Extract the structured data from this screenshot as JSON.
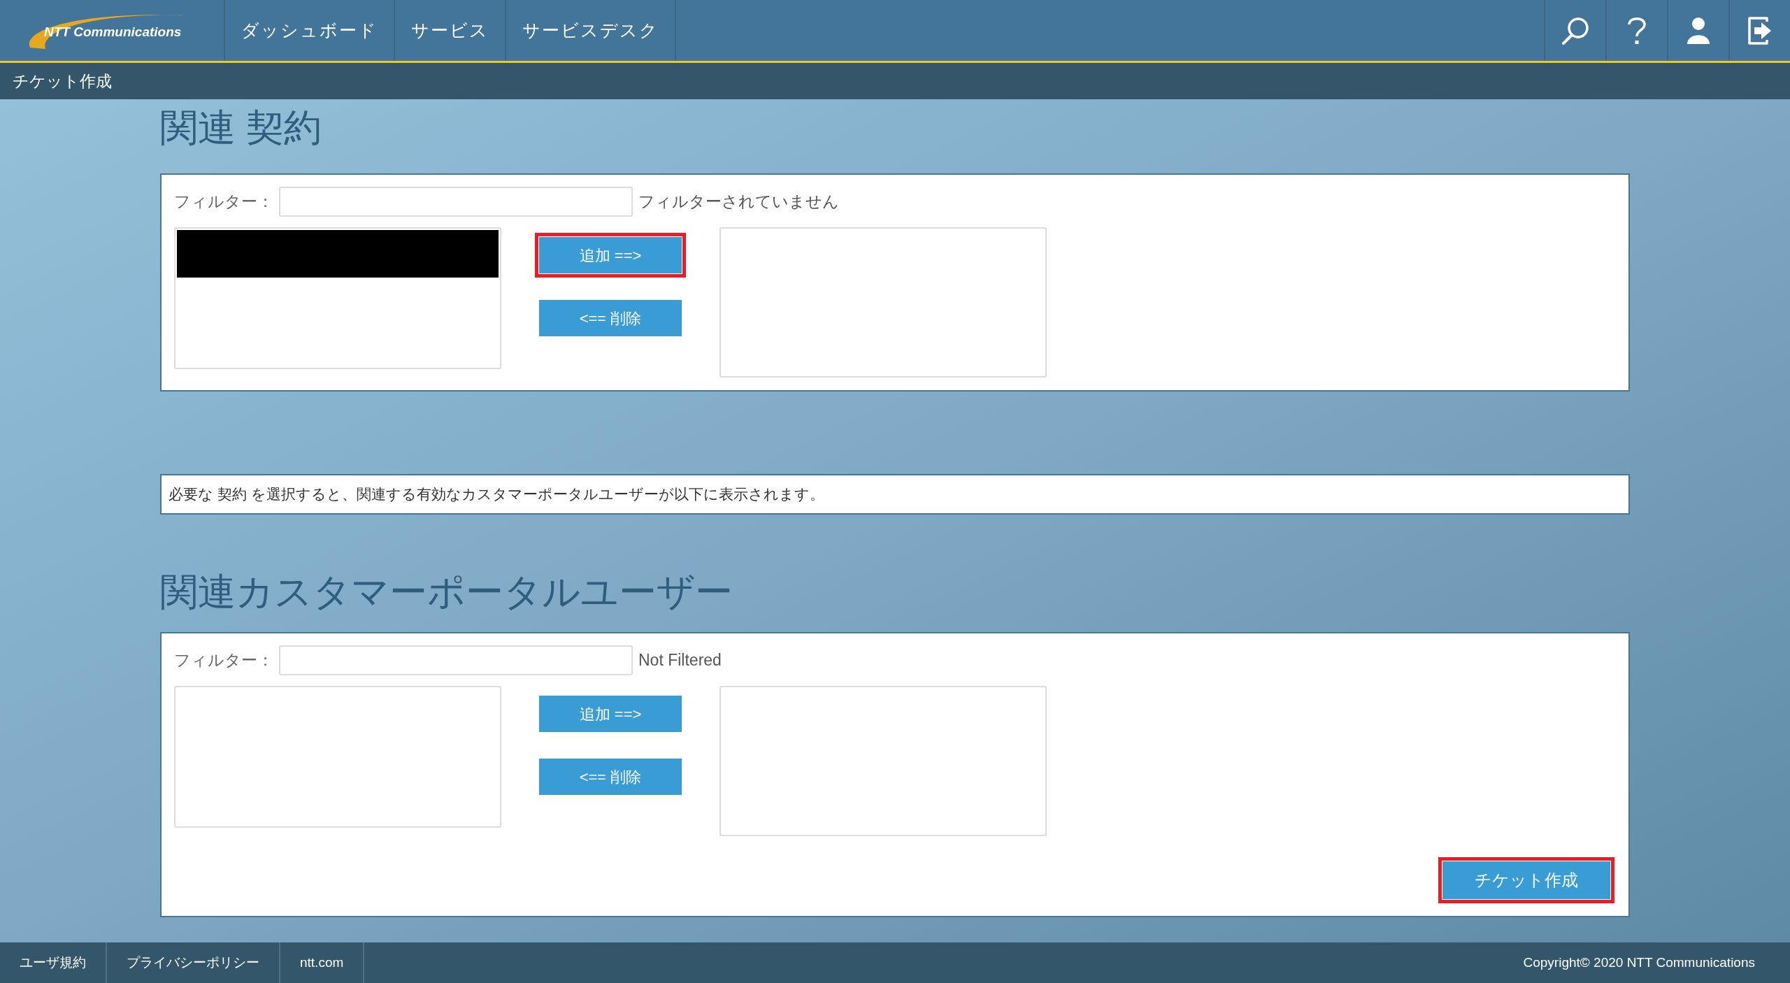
{
  "header": {
    "logo": "NTT Communications",
    "nav": [
      {
        "label": "ダッシュボード"
      },
      {
        "label": "サービス"
      },
      {
        "label": "サービスデスク"
      }
    ]
  },
  "breadcrumb": "チケット作成",
  "sections": [
    {
      "kind": "picker",
      "title": "関連 契約",
      "filter_label": "フィルター：",
      "filter_status": "フィルターされていません",
      "left_items": [
        {
          "kind": "redacted"
        }
      ],
      "add_button": {
        "label": "追加 ==>",
        "highlighted": true
      },
      "remove_button": {
        "label": "<== 削除",
        "highlighted": false
      }
    },
    {
      "kind": "note",
      "text": "必要な 契約 を選択すると、関連する有効なカスタマーポータルユーザーが以下に表示されます。"
    },
    {
      "kind": "picker",
      "title": "関連カスタマーポータルユーザー",
      "filter_label": "フィルター：",
      "filter_status": "Not Filtered",
      "add_button": {
        "label": "追加 ==>",
        "highlighted": false
      },
      "remove_button": {
        "label": "<== 削除",
        "highlighted": false
      },
      "submit_button": {
        "label": "チケット作成",
        "highlighted": true
      }
    }
  ],
  "footer": {
    "links": [
      "ユーザ規約",
      "プライバシーポリシー",
      "ntt.com"
    ],
    "copyright": "Copyright© 2020 NTT Communications"
  }
}
